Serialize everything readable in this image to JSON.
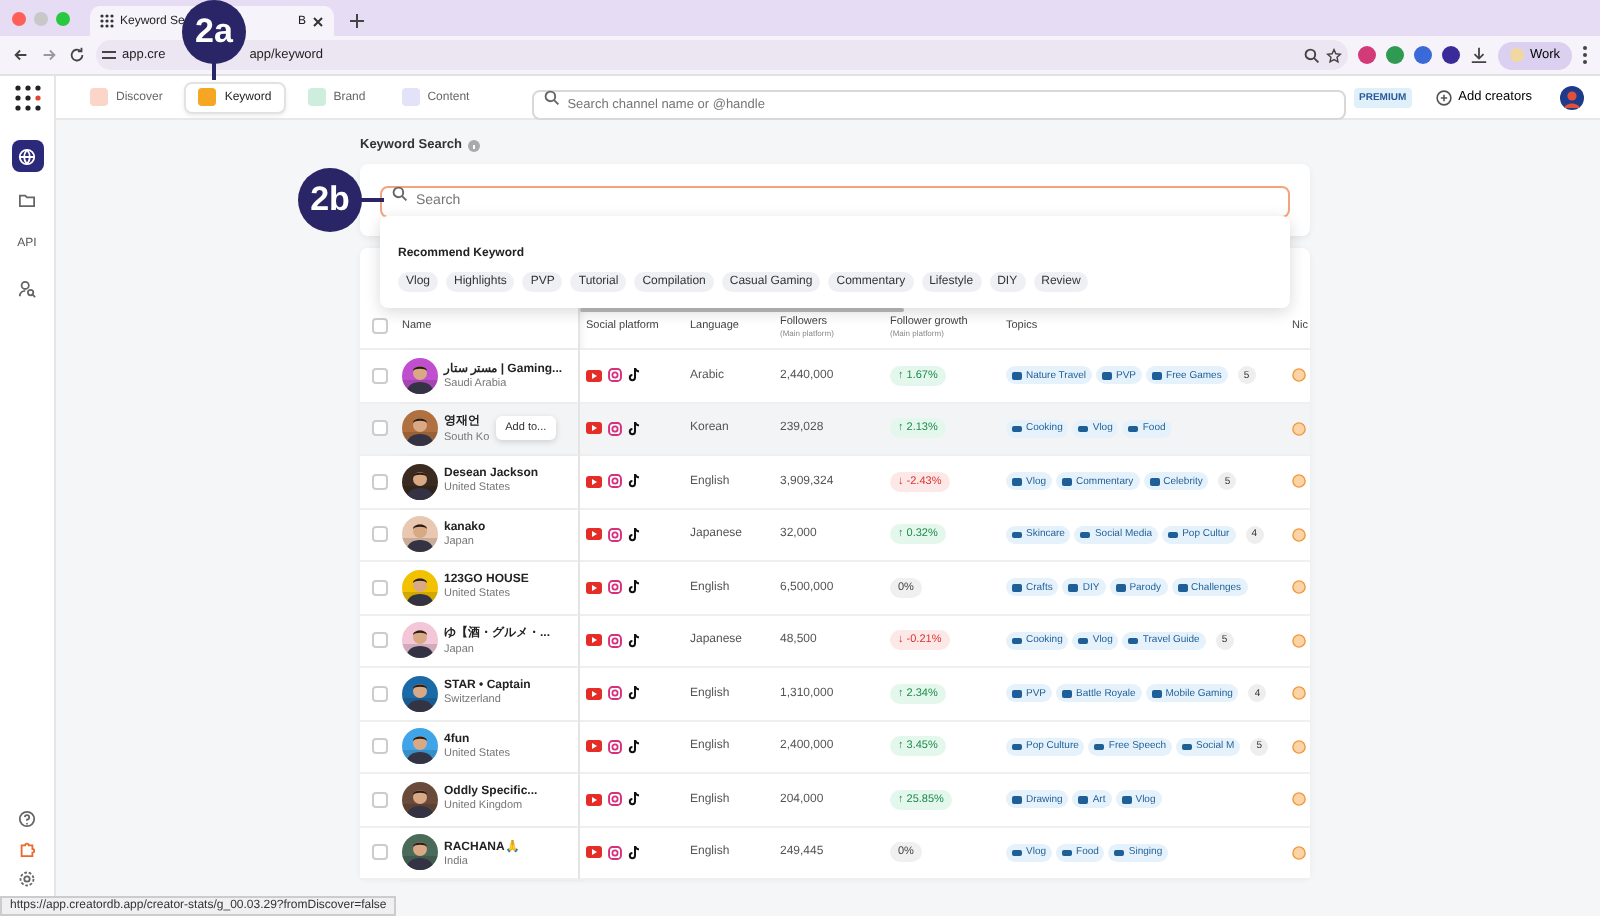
{
  "browser": {
    "tab_title_start": "Keyword Se",
    "tab_title_end": "B",
    "url_start": "app.cre",
    "url_end": "app/keyword",
    "profile": "Work"
  },
  "annotations": [
    {
      "label": "2a"
    },
    {
      "label": "2b"
    }
  ],
  "nav": {
    "tabs": [
      {
        "label": "Discover",
        "selected": false
      },
      {
        "label": "Keyword",
        "selected": true
      },
      {
        "label": "Brand",
        "selected": false
      },
      {
        "label": "Content",
        "selected": false
      }
    ],
    "search_placeholder": "Search channel name or @handle",
    "badge": "PREMIUM",
    "add_button": "Add creators"
  },
  "sidebar": {
    "items": [
      {
        "kind": "globe",
        "selected": true
      },
      {
        "kind": "folder",
        "selected": false
      },
      {
        "kind": "text",
        "label": "API",
        "selected": false
      },
      {
        "kind": "person-search",
        "selected": false
      }
    ]
  },
  "page": {
    "title": "Keyword Search"
  },
  "search": {
    "placeholder": "Search"
  },
  "recommend": {
    "title": "Recommend Keyword",
    "keywords": [
      "Vlog",
      "Highlights",
      "PVP",
      "Tutorial",
      "Compilation",
      "Casual Gaming",
      "Commentary",
      "Lifestyle",
      "DIY",
      "Review"
    ]
  },
  "table": {
    "all_checked": false,
    "columns": [
      {
        "label": "Name"
      },
      {
        "label": "Social platform"
      },
      {
        "label": "Language"
      },
      {
        "label": "Followers",
        "sublabel": "(Main platform)"
      },
      {
        "label": "Follower growth",
        "sublabel": "(Main platform)"
      },
      {
        "label": "Topics"
      },
      {
        "label": "Nic"
      }
    ],
    "rows": [
      {
        "name": "مستر ستار | Gaming...",
        "country": "Saudi Arabia",
        "language": "Arabic",
        "followers": "2,440,000",
        "growth": "↑ 1.67%",
        "kind": "up",
        "topics": [
          "Nature Travel",
          "PVP",
          "Free Games"
        ],
        "more": "5",
        "checked": false,
        "hovered": false
      },
      {
        "name": "영재언",
        "country": "South Ko",
        "tooltip": "Add to...",
        "language": "Korean",
        "followers": "239,028",
        "growth": "↑ 2.13%",
        "kind": "up",
        "topics": [
          "Cooking",
          "Vlog",
          "Food"
        ],
        "checked": false,
        "hovered": true
      },
      {
        "name": "Desean Jackson",
        "country": "United States",
        "language": "English",
        "followers": "3,909,324",
        "growth": "↓ -2.43%",
        "kind": "down",
        "topics": [
          "Vlog",
          "Commentary",
          "Celebrity"
        ],
        "more": "5",
        "checked": false,
        "hovered": false
      },
      {
        "name": "kanako",
        "country": "Japan",
        "language": "Japanese",
        "followers": "32,000",
        "growth": "↑ 0.32%",
        "kind": "up",
        "topics": [
          "Skincare",
          "Social Media",
          "Pop Cultur"
        ],
        "more": "4",
        "checked": false,
        "hovered": false
      },
      {
        "name": "123GO HOUSE",
        "country": "United States",
        "language": "English",
        "followers": "6,500,000",
        "growth": "0%",
        "kind": "flat",
        "topics": [
          "Crafts",
          "DIY",
          "Parody",
          "Challenges"
        ],
        "checked": false,
        "hovered": false
      },
      {
        "name": "ゆ【酒・グルメ・...",
        "country": "Japan",
        "language": "Japanese",
        "followers": "48,500",
        "growth": "↓ -0.21%",
        "kind": "down",
        "topics": [
          "Cooking",
          "Vlog",
          "Travel Guide"
        ],
        "more": "5",
        "checked": false,
        "hovered": false
      },
      {
        "name": "STAR • Captain",
        "country": "Switzerland",
        "language": "English",
        "followers": "1,310,000",
        "growth": "↑ 2.34%",
        "kind": "up",
        "topics": [
          "PVP",
          "Battle Royale",
          "Mobile Gaming"
        ],
        "more": "4",
        "checked": false,
        "hovered": false
      },
      {
        "name": "4fun",
        "country": "United States",
        "language": "English",
        "followers": "2,400,000",
        "growth": "↑ 3.45%",
        "kind": "up",
        "topics": [
          "Pop Culture",
          "Free Speech",
          "Social M"
        ],
        "more": "5",
        "checked": false,
        "hovered": false
      },
      {
        "name": "Oddly Specific...",
        "country": "United Kingdom",
        "language": "English",
        "followers": "204,000",
        "growth": "↑ 25.85%",
        "kind": "up",
        "topics": [
          "Drawing",
          "Art",
          "Vlog"
        ],
        "checked": false,
        "hovered": false
      },
      {
        "name": "RACHANA🙏",
        "country": "India",
        "language": "English",
        "followers": "249,445",
        "growth": "0%",
        "kind": "flat",
        "topics": [
          "Vlog",
          "Food",
          "Singing"
        ],
        "checked": false,
        "hovered": false
      }
    ]
  },
  "status_bar": {
    "url": "https://app.creatordb.app/creator-stats/g_00.03.29?fromDiscover=false"
  }
}
